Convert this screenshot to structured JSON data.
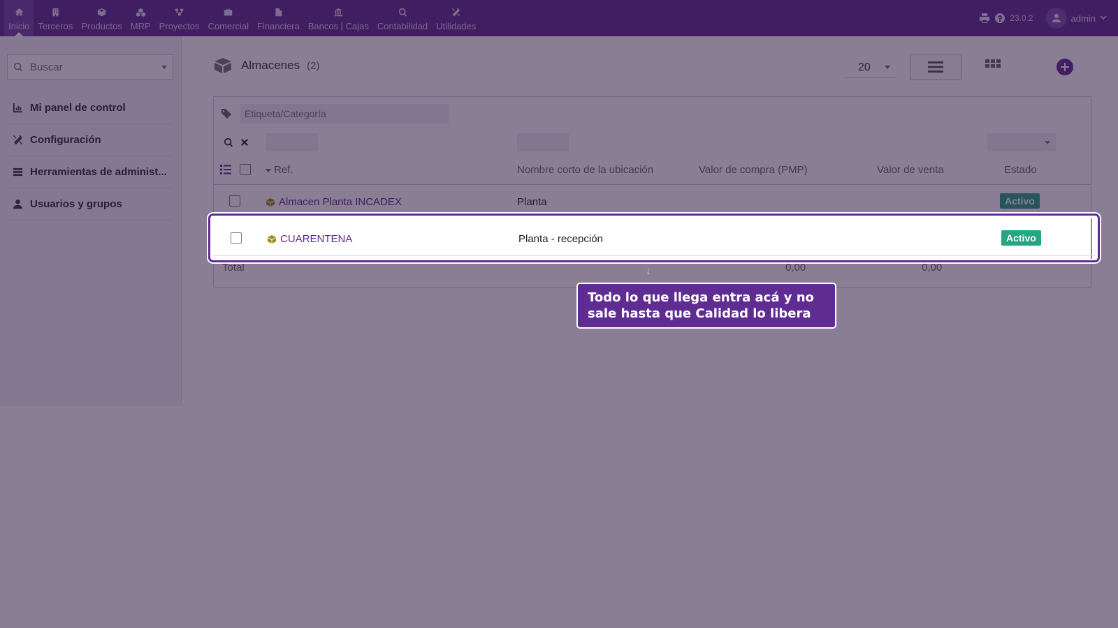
{
  "nav": {
    "items": [
      {
        "label": "Inicio",
        "icon": "home-icon"
      },
      {
        "label": "Terceros",
        "icon": "building-icon"
      },
      {
        "label": "Productos",
        "icon": "cube-icon"
      },
      {
        "label": "MRP",
        "icon": "cubes-icon"
      },
      {
        "label": "Proyectos",
        "icon": "sitemap-icon"
      },
      {
        "label": "Comercial",
        "icon": "briefcase-icon"
      },
      {
        "label": "Financiera",
        "icon": "file-icon"
      },
      {
        "label": "Bancos | Cajas",
        "icon": "bank-icon"
      },
      {
        "label": "Contabilidad",
        "icon": "search-dollar-icon"
      },
      {
        "label": "Utilidades",
        "icon": "tools-icon"
      }
    ],
    "version": "23.0.2",
    "user": "admin"
  },
  "sidebar": {
    "search_placeholder": "Buscar",
    "items": [
      {
        "label": "Mi panel de control",
        "icon": "chart-icon"
      },
      {
        "label": "Configuración",
        "icon": "tools-icon"
      },
      {
        "label": "Herramientas de administ...",
        "icon": "server-icon"
      },
      {
        "label": "Usuarios y grupos",
        "icon": "user-icon"
      }
    ]
  },
  "page": {
    "title": "Almacenes",
    "count": "(2)",
    "per_page": "20",
    "tag_placeholder": "Etiqueta/Categoría"
  },
  "table": {
    "columns": {
      "ref": "Ref.",
      "location": "Nombre corto de la ubicación",
      "purchase_value": "Valor de compra (PMP)",
      "sale_value": "Valor de venta",
      "status": "Estado"
    },
    "rows": [
      {
        "ref": "Almacen Planta INCADEX",
        "location": "Planta",
        "status": "Activo"
      },
      {
        "ref": "CUARENTENA",
        "location": "Planta - recepción",
        "status": "Activo"
      }
    ],
    "total": {
      "label": "Total",
      "purchase": "0,00",
      "sale": "0,00"
    }
  },
  "tooltip": {
    "text": "Todo lo que llega entra acá y no sale hasta que Calidad lo libera",
    "arrow": "↓"
  }
}
